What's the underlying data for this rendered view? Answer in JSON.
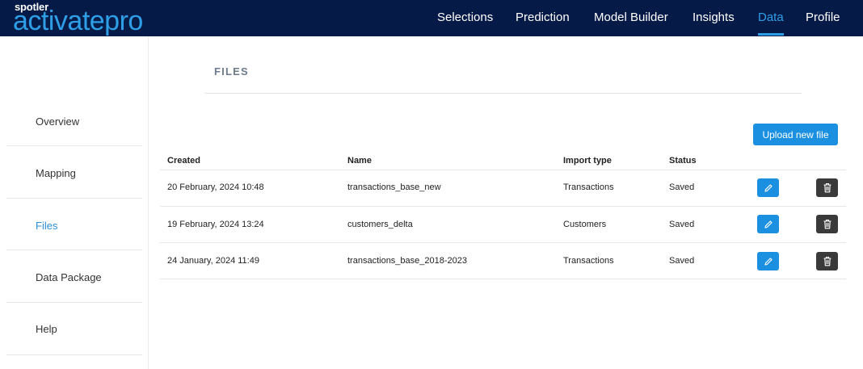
{
  "brand": {
    "small": "spotler",
    "big": "activatepro"
  },
  "nav": {
    "items": [
      {
        "label": "Selections",
        "active": false
      },
      {
        "label": "Prediction",
        "active": false
      },
      {
        "label": "Model Builder",
        "active": false
      },
      {
        "label": "Insights",
        "active": false
      },
      {
        "label": "Data",
        "active": true
      },
      {
        "label": "Profile",
        "active": false
      }
    ]
  },
  "sidebar": {
    "items": [
      {
        "label": "Overview",
        "active": false
      },
      {
        "label": "Mapping",
        "active": false
      },
      {
        "label": "Files",
        "active": true
      },
      {
        "label": "Data Package",
        "active": false
      },
      {
        "label": "Help",
        "active": false
      }
    ]
  },
  "main": {
    "title": "FILES",
    "upload_label": "Upload new file",
    "columns": [
      "Created",
      "Name",
      "Import type",
      "Status"
    ],
    "rows": [
      {
        "created": "20 February, 2024 10:48",
        "name": "transactions_base_new",
        "import_type": "Transactions",
        "status": "Saved"
      },
      {
        "created": "19 February, 2024 13:24",
        "name": "customers_delta",
        "import_type": "Customers",
        "status": "Saved"
      },
      {
        "created": "24 January, 2024 11:49",
        "name": "transactions_base_2018-2023",
        "import_type": "Transactions",
        "status": "Saved"
      }
    ],
    "row_actions": {
      "edit_icon": "pencil-icon",
      "delete_icon": "trash-icon"
    }
  },
  "colors": {
    "topbar": "#061a48",
    "accent": "#2e9fe6",
    "button": "#1b8fe0",
    "delete_button": "#3a3a3a"
  }
}
